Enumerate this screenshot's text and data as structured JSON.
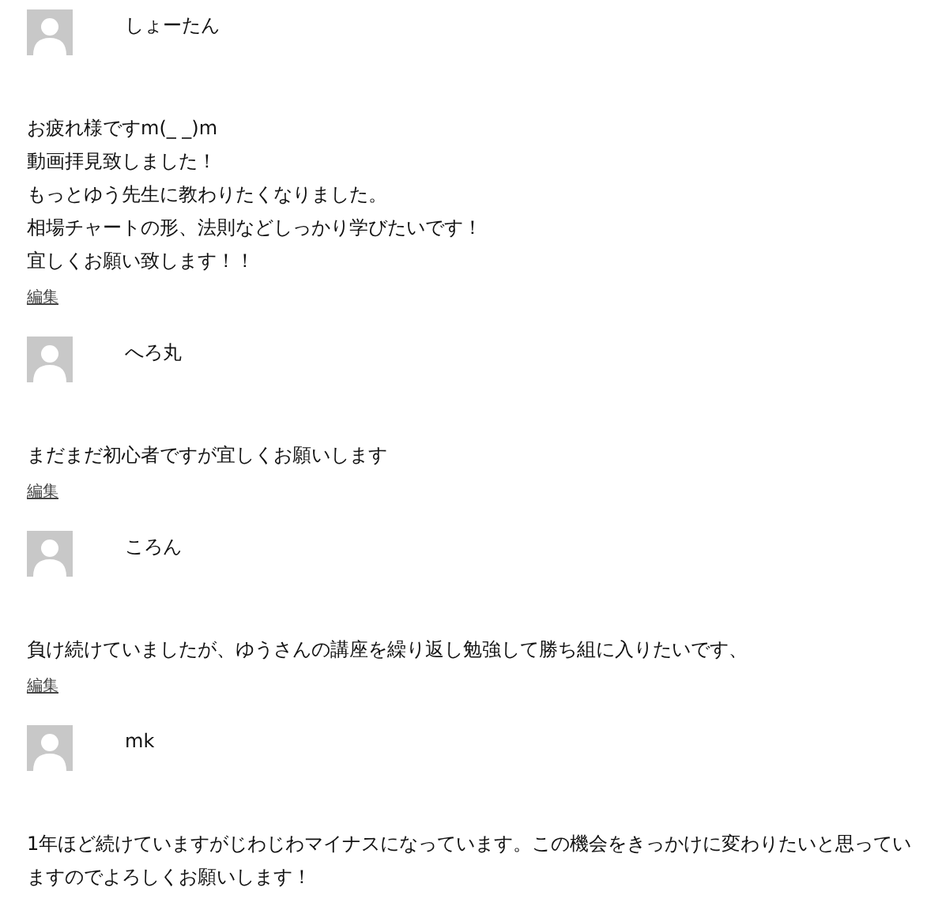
{
  "comments": [
    {
      "author": "しょーたん",
      "lines": [
        "お疲れ様ですm(_ _)m",
        "動画拝見致しました！",
        "もっとゆう先生に教わりたくなりました。",
        "相場チャートの形、法則などしっかり学びたいです！",
        "宜しくお願い致します！！"
      ],
      "edit": "編集"
    },
    {
      "author": "へろ丸",
      "lines": [
        "まだまだ初心者ですが宜しくお願いします"
      ],
      "edit": "編集"
    },
    {
      "author": "ころん",
      "lines": [
        "負け続けていましたが、ゆうさんの講座を繰り返し勉強して勝ち組に入りたいです、"
      ],
      "edit": "編集"
    },
    {
      "author": "mk",
      "lines": [
        "1年ほど続けていますがじわじわマイナスになっています。この機会をきっかけに変わりたいと思っていますのでよろしくお願いします！"
      ]
    }
  ]
}
